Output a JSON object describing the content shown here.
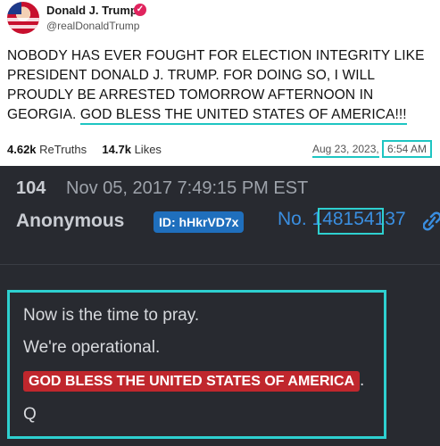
{
  "post": {
    "display_name": "Donald J. Trump",
    "verified_icon": "verified-badge-icon",
    "handle": "@realDonaldTrump",
    "body_main": "NOBODY HAS EVER FOUGHT FOR ELECTION INTEGRITY LIKE PRESIDENT DONALD J. TRUMP. FOR DOING SO, I WILL PROUDLY BE ARRESTED TOMORROW AFTERNOON IN GEORGIA.",
    "body_highlight": "GOD BLESS THE UNITED STATES OF AMERICA!!!",
    "retruths_count": "4.62k",
    "retruths_label": "ReTruths",
    "likes_count": "14.7k",
    "likes_label": "Likes",
    "date": "Aug 23, 2023,",
    "time": "6:54 AM"
  },
  "board": {
    "post_number": "104",
    "datetime": "Nov 05, 2017 7:49:15 PM EST",
    "author": "Anonymous",
    "id_badge": "ID: hHkrVD7x",
    "no_prefix": "No. 1",
    "no_highlight": "48154",
    "no_suffix": "137",
    "lines": {
      "l1": "Now is the time to pray.",
      "l2": "We're operational.",
      "l3_red": "GOD BLESS THE UNITED STATES OF AMERICA",
      "l3_tail": ".",
      "l4": "Q"
    }
  },
  "colors": {
    "highlight": "#1ec5c2",
    "board_bg": "#282a30",
    "id_badge_bg": "#1f6fbd",
    "red_label": "#c0272d",
    "link_blue": "#3a8ee0"
  }
}
